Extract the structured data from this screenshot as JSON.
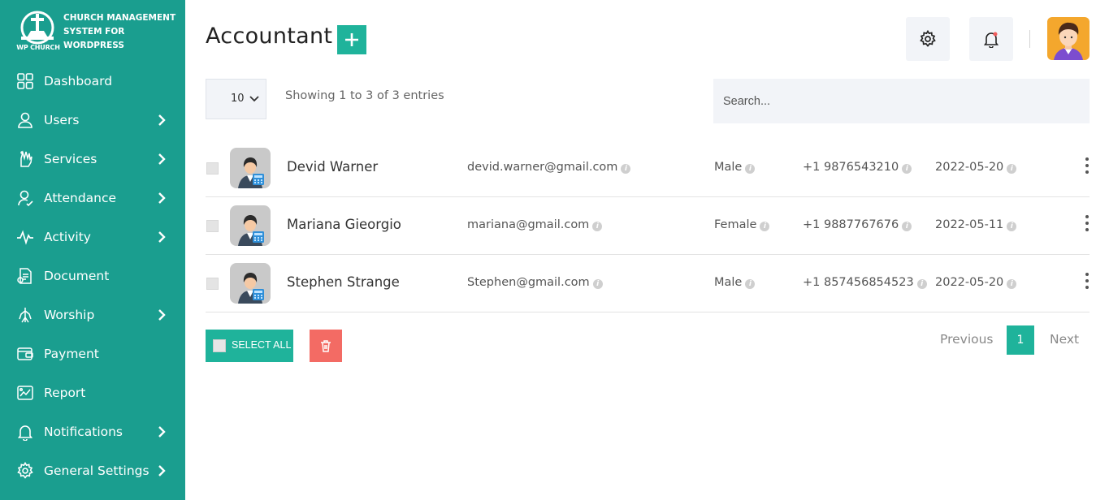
{
  "brand": {
    "title": "Church Management System for WordPress",
    "logo_text": "WP CHURCH"
  },
  "sidebar": {
    "items": [
      {
        "label": "Dashboard",
        "icon": "grid-icon",
        "has_submenu": false
      },
      {
        "label": "Users",
        "icon": "user-icon",
        "has_submenu": true
      },
      {
        "label": "Services",
        "icon": "hand-icon",
        "has_submenu": true
      },
      {
        "label": "Attendance",
        "icon": "user-check-icon",
        "has_submenu": true
      },
      {
        "label": "Activity",
        "icon": "activity-icon",
        "has_submenu": true
      },
      {
        "label": "Document",
        "icon": "document-icon",
        "has_submenu": false
      },
      {
        "label": "Worship",
        "icon": "worship-icon",
        "has_submenu": true
      },
      {
        "label": "Payment",
        "icon": "payment-icon",
        "has_submenu": false
      },
      {
        "label": "Report",
        "icon": "report-icon",
        "has_submenu": false
      },
      {
        "label": "Notifications",
        "icon": "bell-icon",
        "has_submenu": true
      },
      {
        "label": "General Settings",
        "icon": "gear-icon",
        "has_submenu": true
      }
    ]
  },
  "header": {
    "title": "Accountant",
    "add_icon": "plus-icon",
    "settings_icon": "gear-icon",
    "notification_icon": "bell-icon"
  },
  "controls": {
    "page_size": "10",
    "entries_info": "Showing 1 to 3 of 3 entries",
    "search_placeholder": "Search..."
  },
  "table": {
    "rows": [
      {
        "name": "Devid Warner",
        "email": "devid.warner@gmail.com",
        "gender": "Male",
        "phone": "+1 9876543210",
        "date": "2022-05-20"
      },
      {
        "name": "Mariana Gieorgio",
        "email": "mariana@gmail.com",
        "gender": "Female",
        "phone": "+1 9887767676",
        "date": "2022-05-11"
      },
      {
        "name": "Stephen Strange",
        "email": "Stephen@gmail.com",
        "gender": "Male",
        "phone": "+1 857456854523",
        "date": "2022-05-20"
      }
    ]
  },
  "footer": {
    "select_all_label": "SELECT ALL",
    "delete_icon": "trash-icon"
  },
  "pagination": {
    "previous": "Previous",
    "current": "1",
    "next": "Next"
  },
  "colors": {
    "sidebar": "#1a9e8f",
    "accent": "#1fb39b",
    "danger": "#f36b64",
    "avatar_bg": "#f4a72d"
  }
}
